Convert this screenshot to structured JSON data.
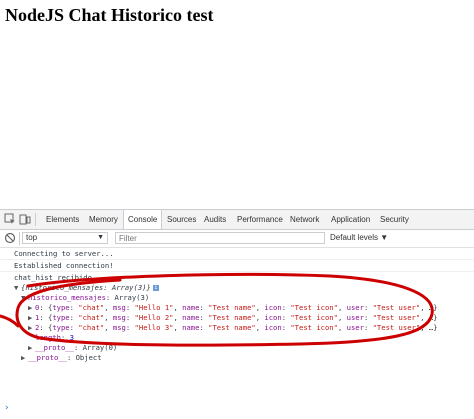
{
  "page": {
    "title": "NodeJS Chat Historico test"
  },
  "devtools": {
    "tabs": [
      "Elements",
      "Memory",
      "Console",
      "Sources",
      "Audits",
      "Performance",
      "Network",
      "Application",
      "Security"
    ],
    "active_tab": "Console",
    "context": "top",
    "filter_placeholder": "Filter",
    "levels_label": "Default levels",
    "levels_arrow": "▼"
  },
  "console": {
    "lines": [
      "Connecting to server...",
      "Established connection!",
      "chat_hist recibido"
    ],
    "object_summary": "{historico_mensajes: Array(3)}",
    "array_label_key": "historico_mensajes",
    "array_label_value": "Array(3)",
    "items": [
      {
        "index": "0",
        "type": "\"chat\"",
        "msg": "\"Hello 1\"",
        "name": "\"Test name\"",
        "icon": "\"Test icon\"",
        "user": "\"Test user\""
      },
      {
        "index": "1",
        "type": "\"chat\"",
        "msg": "\"Hello 2\"",
        "name": "\"Test name\"",
        "icon": "\"Test icon\"",
        "user": "\"Test user\""
      },
      {
        "index": "2",
        "type": "\"chat\"",
        "msg": "\"Hello 3\"",
        "name": "\"Test name\"",
        "icon": "\"Test icon\"",
        "user": "\"Test user\""
      }
    ],
    "length_key": "length",
    "length_value": "3",
    "proto_key": "__proto__",
    "array_proto_value": "Array(0)",
    "object_proto_value": "Object",
    "prompt_symbol": "›"
  },
  "colors": {
    "annotation": "#cc0000",
    "active_tab_accent": "#1a73e8"
  }
}
